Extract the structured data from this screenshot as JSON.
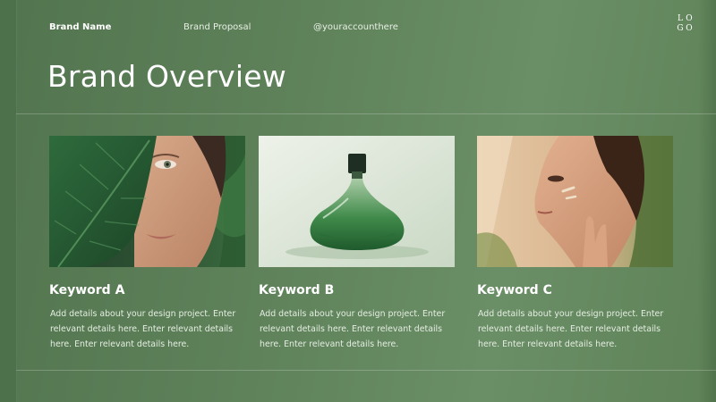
{
  "header": {
    "brand_name": "Brand Name",
    "proposal": "Brand Proposal",
    "account": "@youraccounthere",
    "logo_letters": [
      "L",
      "O",
      "G",
      "O"
    ]
  },
  "title": "Brand Overview",
  "cards": [
    {
      "keyword": "Keyword A",
      "details": "Add details about your design project. Enter relevant details here. Enter relevant details here. Enter relevant details here."
    },
    {
      "keyword": "Keyword B",
      "details": "Add details about your design project. Enter relevant details here. Enter relevant details here. Enter relevant details here."
    },
    {
      "keyword": "Keyword C",
      "details": "Add details about your design project. Enter relevant details here. Enter relevant details here. Enter relevant details here."
    }
  ],
  "colors": {
    "background": "#5d8059",
    "text": "#ffffff",
    "muted_text": "#e5ede2"
  }
}
